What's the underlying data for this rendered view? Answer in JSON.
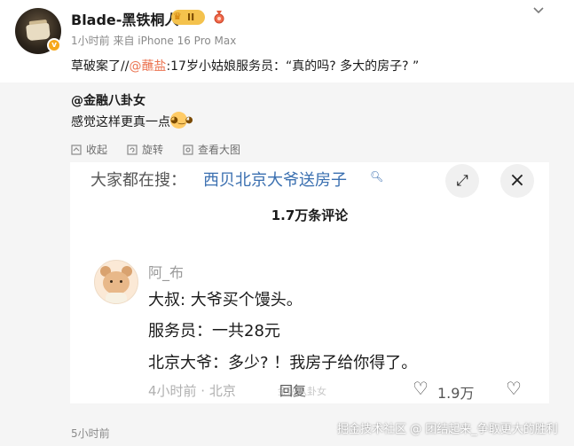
{
  "post": {
    "username": "Blade-黑铁桐人",
    "vip_level": "II",
    "meta": "1小时前 来自 iPhone 16 Pro Max",
    "text_prefix": "草破案了//",
    "mention": "@蘸盐",
    "text_suffix": ":17岁小姑娘服务员：“真的吗? 多大的房子? ”",
    "more_icon": "chevron-down-icon"
  },
  "repost": {
    "author": "@金融八卦女",
    "text": "感觉这样更真一点",
    "toolbar": {
      "collapse": "收起",
      "rotate": "旋转",
      "view_full": "查看大图"
    },
    "screenshot": {
      "search_prefix": "大家都在搜：",
      "search_term": "西贝北京大爷送房子",
      "comment_count": "1.7万条评论",
      "commenter": "阿_布",
      "lines": [
        "大叔: 大爷买个馒头。",
        "服务员：一共28元",
        "北京大爷：多少? ！我房子给你得了。"
      ],
      "meta": "4小时前 · 北京",
      "reply": "回复",
      "likes": "1.9万",
      "watermark": "金融八卦女"
    }
  },
  "footer": {
    "time": "5小时前",
    "watermark": "掘金技术社区 @ 团结起来_争取更大的胜利"
  },
  "colors": {
    "mention": "#eb7350",
    "search_term": "#3a6fb0",
    "vip_badge": "#f4c24d",
    "verified": "#f6a71c"
  }
}
